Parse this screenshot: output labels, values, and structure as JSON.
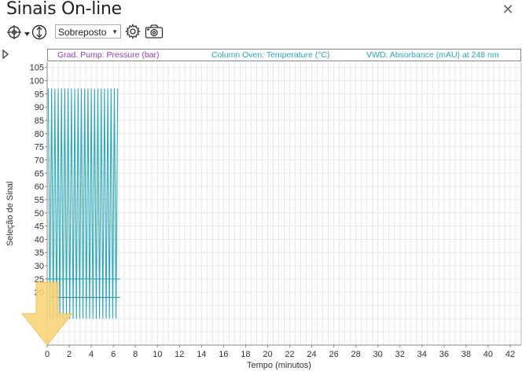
{
  "window": {
    "title": "Sinais On-line",
    "close_icon": "close-icon"
  },
  "toolbar": {
    "zoom_icon": "zoom-crosshair-icon",
    "dropdown_icon": "chevron-down-icon",
    "vertical_scale_icon": "vertical-scale-icon",
    "view_mode": "Sobreposto",
    "settings_icon": "gear-icon",
    "snapshot_icon": "camera-icon"
  },
  "panel": {
    "expander_icon": "expand-arrow-icon"
  },
  "legend": [
    {
      "label": "Grad. Pump: Pressure (bar)",
      "color": "#8a3fb5"
    },
    {
      "label": "Column Oven: Temperature (°C)",
      "color": "#2aa8b8"
    },
    {
      "label": "VWD: Absorbance (mAU) at 248 nm",
      "color": "#2aa8b8"
    }
  ],
  "chart_data": {
    "type": "line",
    "xlabel": "Tempo (minutos)",
    "ylabel": "Seleção de Sinal",
    "xlim": [
      0,
      43
    ],
    "ylim": [
      0,
      107
    ],
    "x_ticks": [
      0,
      2,
      4,
      6,
      8,
      10,
      12,
      14,
      16,
      18,
      20,
      22,
      24,
      26,
      28,
      30,
      32,
      34,
      36,
      38,
      40,
      42
    ],
    "y_ticks": [
      20,
      25,
      30,
      35,
      40,
      45,
      50,
      55,
      60,
      65,
      70,
      75,
      80,
      85,
      90,
      95,
      100,
      105
    ],
    "grid": true,
    "series": [
      {
        "name": "VWD: Absorbance (mAU) at 248 nm",
        "color": "#2aa8b8",
        "oscillation": {
          "x_start": 0.1,
          "x_end": 6.5,
          "period": 0.3,
          "high": 97,
          "low": 10
        }
      },
      {
        "name": "Column Oven: Temperature (°C)",
        "color": "#2aa8b8",
        "x": [
          0,
          6.6
        ],
        "y": [
          25,
          25
        ]
      },
      {
        "name": "Grad. Pump: Pressure (bar)",
        "color": "#3a8aa0",
        "x": [
          0,
          6.6
        ],
        "y": [
          18,
          18
        ]
      }
    ],
    "annotation": {
      "type": "down-arrow",
      "color": "#f7d57a",
      "at_x": 0
    }
  }
}
